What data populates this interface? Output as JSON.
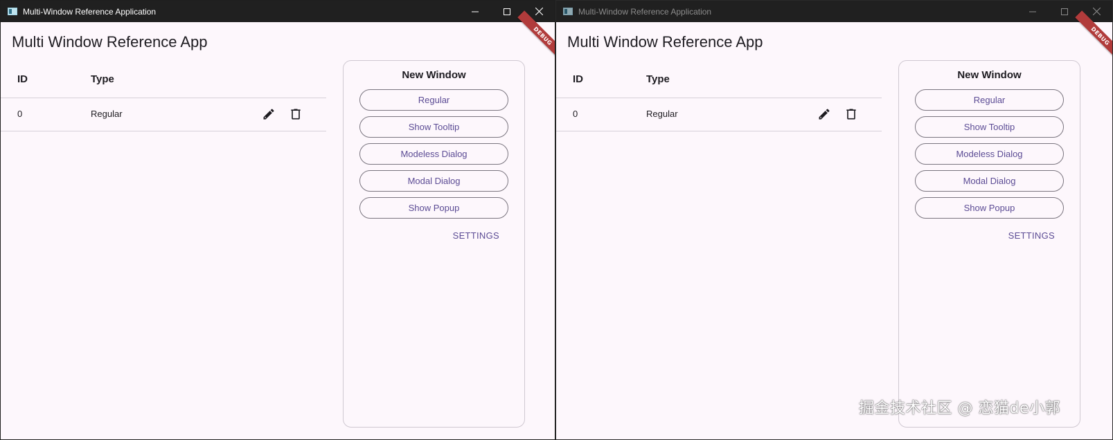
{
  "windows": [
    {
      "title": "Multi-Window Reference Application",
      "app_title": "Multi Window Reference App",
      "debug_badge": "DEBUG",
      "table": {
        "headers": {
          "id": "ID",
          "type": "Type"
        },
        "rows": [
          {
            "id": "0",
            "type": "Regular"
          }
        ]
      },
      "panel": {
        "title": "New Window",
        "buttons": [
          "Regular",
          "Show Tooltip",
          "Modeless Dialog",
          "Modal Dialog",
          "Show Popup"
        ],
        "settings": "SETTINGS"
      },
      "controls": {
        "minimize": "–",
        "maximize": "☐",
        "close": "✕"
      }
    },
    {
      "title": "Multi-Window Reference Application",
      "app_title": "Multi Window Reference App",
      "debug_badge": "DEBUG",
      "table": {
        "headers": {
          "id": "ID",
          "type": "Type"
        },
        "rows": [
          {
            "id": "0",
            "type": "Regular"
          }
        ]
      },
      "panel": {
        "title": "New Window",
        "buttons": [
          "Regular",
          "Show Tooltip",
          "Modeless Dialog",
          "Modal Dialog",
          "Show Popup"
        ],
        "settings": "SETTINGS"
      },
      "controls": {
        "minimize": "–",
        "maximize": "☐",
        "close": "✕"
      }
    }
  ],
  "watermark": "掘金技术社区 @ 恋猫de小郭",
  "colors": {
    "accent": "#5b4b94",
    "surface": "#fdf7fc",
    "titlebar": "#202020",
    "debug_ribbon": "#b13b3b"
  },
  "icons": {
    "edit": "pencil-icon",
    "delete": "trash-icon"
  }
}
